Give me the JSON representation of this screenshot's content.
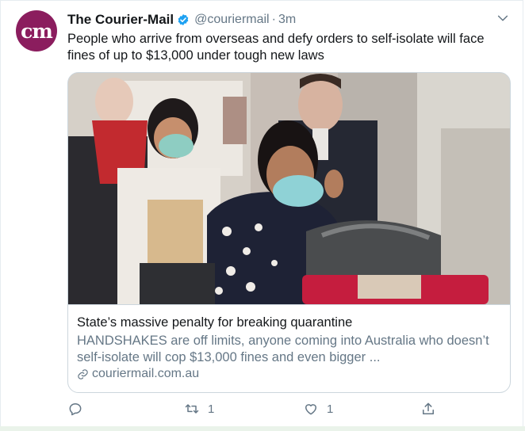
{
  "tweet": {
    "author_name": "The Courier-Mail",
    "avatar_text": "cm",
    "handle": "@couriermail",
    "separator": "·",
    "time": "3m",
    "text": "People who arrive from overseas and defy orders to self-isolate will face fines of up to $13,000 under tough new laws"
  },
  "card": {
    "title": "State’s massive penalty for breaking quarantine",
    "description": "HANDSHAKES are off limits, anyone coming into Australia who doesn’t self-isolate will cop $13,000 fines and even bigger ...",
    "domain": "couriermail.com.au"
  },
  "actions": {
    "reply_count": "",
    "retweet_count": "1",
    "like_count": "1"
  },
  "colors": {
    "avatar_bg": "#8b1d5e",
    "verified": "#1da1f2",
    "secondary_text": "#657786"
  },
  "icons": [
    "verified-badge-icon",
    "chevron-down-icon",
    "link-icon",
    "reply-icon",
    "retweet-icon",
    "like-icon",
    "share-icon"
  ]
}
